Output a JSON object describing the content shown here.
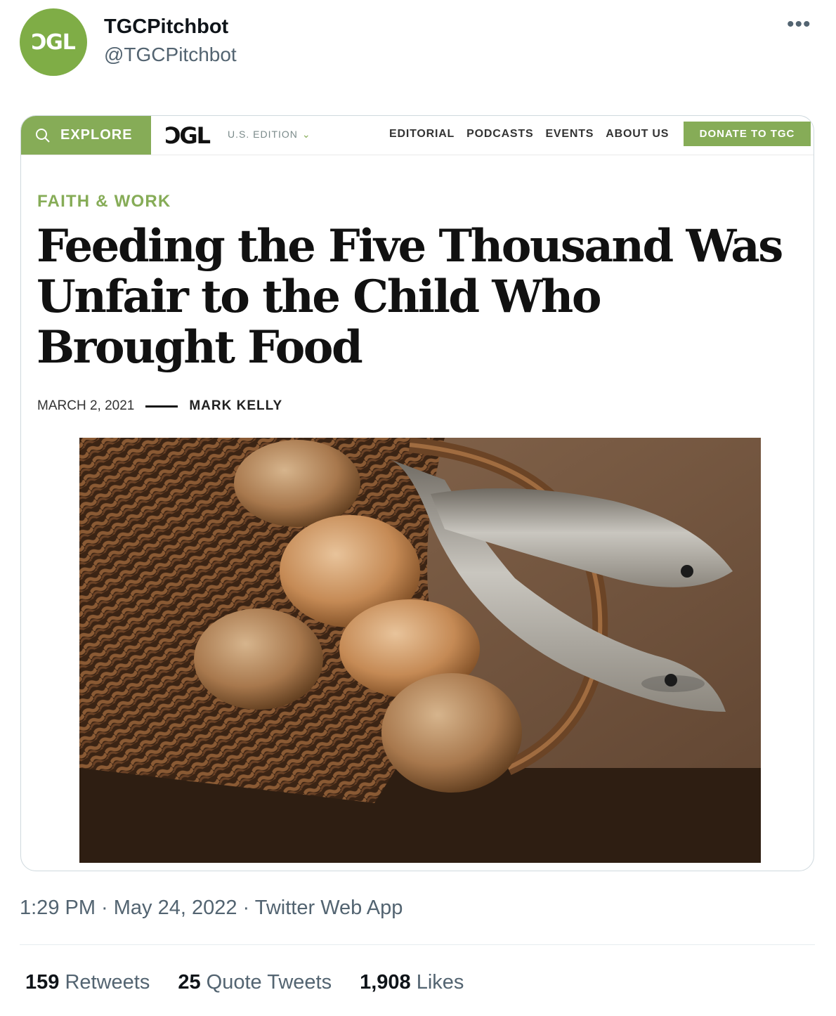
{
  "tweet": {
    "avatar_text": "ϽGL",
    "display_name": "TGCPitchbot",
    "handle": "@TGCPitchbot",
    "more_icon": "more-horizontal-icon",
    "timestamp": "1:29 PM · May 24, 2022 · Twitter Web App",
    "stats": {
      "retweets_count": "159",
      "retweets_label": "Retweets",
      "quotes_count": "25",
      "quotes_label": "Quote Tweets",
      "likes_count": "1,908",
      "likes_label": "Likes"
    }
  },
  "article": {
    "nav": {
      "explore_label": "EXPLORE",
      "search_icon": "search-icon",
      "logo_text": "ϽGL",
      "edition_label": "U.S. EDITION",
      "edition_icon": "chevron-down-icon",
      "links": [
        "EDITORIAL",
        "PODCASTS",
        "EVENTS",
        "ABOUT US"
      ],
      "donate_label": "DONATE TO TGC"
    },
    "category": "FAITH & WORK",
    "headline_lines": [
      "Feeding the Five Thousand Was",
      "Unfair to the Child Who",
      "Brought Food"
    ],
    "date": "MARCH 2, 2021",
    "author": "MARK KELLY",
    "image_subject": "basket-of-bread-and-fish-photo"
  },
  "colors": {
    "brand_green": "#86ac57",
    "avatar_green": "#7fad46",
    "secondary_text": "#536471",
    "border": "#cfd9de"
  }
}
